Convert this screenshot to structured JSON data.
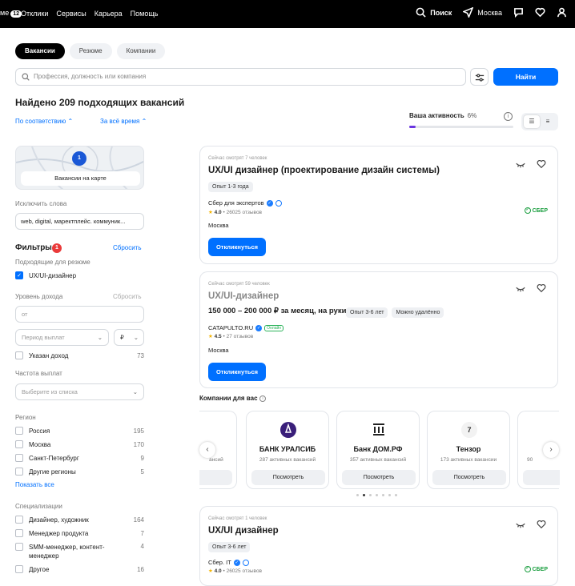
{
  "topbar": {
    "logo_suffix": "ме",
    "logo_badge": "12",
    "nav": [
      "Отклики",
      "Сервисы",
      "Карьера",
      "Помощь"
    ],
    "search_label": "Поиск",
    "city": "Москва"
  },
  "tabs": [
    "Вакансии",
    "Резюме",
    "Компании"
  ],
  "search": {
    "placeholder": "Профессия, должность или компания",
    "button": "Найти"
  },
  "results": {
    "found": "Найдено 209 подходящих вакансий",
    "sort": "По соответствию",
    "period": "За всё время"
  },
  "activity": {
    "label": "Ваша активность",
    "percent": "6%",
    "progress": 0.06
  },
  "sidebar": {
    "map_button": "Вакансии на карте",
    "map_pin": "1",
    "exclude_label": "Исключить слова",
    "exclude_value": "web, digital, маректплейс. коммуник...",
    "filters_title": "Фильтры",
    "filters_count": "1",
    "reset": "Сбросить",
    "resume_label": "Подходящие для резюме",
    "resume_item": "UX/UI-дизайнер",
    "income_label": "Уровень дохода",
    "income_reset": "Сбросить",
    "income_from": "от",
    "pay_period": "Период выплат",
    "currency": "₽",
    "income_check": "Указан доход",
    "income_count": "73",
    "freq_label": "Частота выплат",
    "freq_placeholder": "Выберите из списка",
    "region_label": "Регион",
    "regions": [
      {
        "name": "Россия",
        "count": "195"
      },
      {
        "name": "Москва",
        "count": "170"
      },
      {
        "name": "Санкт-Петербург",
        "count": "9"
      },
      {
        "name": "Другие регионы",
        "count": "5"
      }
    ],
    "show_all": "Показать все",
    "spec_label": "Специализации",
    "specs": [
      {
        "name": "Дизайнер, художник",
        "count": "164"
      },
      {
        "name": "Менеджер продукта",
        "count": "7"
      },
      {
        "name": "SMM-менеджер, контент-менеджер",
        "count": "4"
      },
      {
        "name": "Другое",
        "count": "16"
      }
    ]
  },
  "vacancies": [
    {
      "watching": "Сейчас смотрят 7 человек",
      "title": "UX/UI дизайнер (проектирование дизайн системы)",
      "chips": [
        "Опыт 1-3 года"
      ],
      "company": "Сбер для экспертов",
      "rating": "4.0",
      "reviews": "26025 отзывов",
      "city": "Москва",
      "apply": "Откликнуться",
      "brand": "СБЕР"
    },
    {
      "watching": "Сейчас смотрят 59 человек",
      "title": "UX/UI-дизайнер",
      "salary": "150 000 – 200 000 ₽ за месяц, на руки",
      "chips": [
        "Опыт 3-6 лет",
        "Можно удалённо"
      ],
      "company": "CATAPULTO.RU",
      "online": "Онлайн",
      "rating": "4.5",
      "reviews": "27 отзывов",
      "city": "Москва",
      "apply": "Откликнуться"
    },
    {
      "watching": "Сейчас смотрят 1 человек",
      "title": "UX/UI дизайнер",
      "chips": [
        "Опыт 3-6 лет"
      ],
      "company": "Сбер. IT",
      "rating": "4.0",
      "reviews": "26025 отзывов",
      "brand": "СБЕР"
    }
  ],
  "companies": {
    "title": "Компании для вас",
    "partial_vac": "ансий",
    "partial_right": "90",
    "view": "Посмотреть",
    "items": [
      {
        "name": "БАНК УРАЛСИБ",
        "vacancies": "287 активных вакансий",
        "color": "#3a1f7a"
      },
      {
        "name": "Банк ДОМ.РФ",
        "vacancies": "357 активных вакансий",
        "color": "#222222"
      },
      {
        "name": "Тензор",
        "vacancies": "173 активных вакансии",
        "color": "#f2f2f2"
      }
    ]
  }
}
